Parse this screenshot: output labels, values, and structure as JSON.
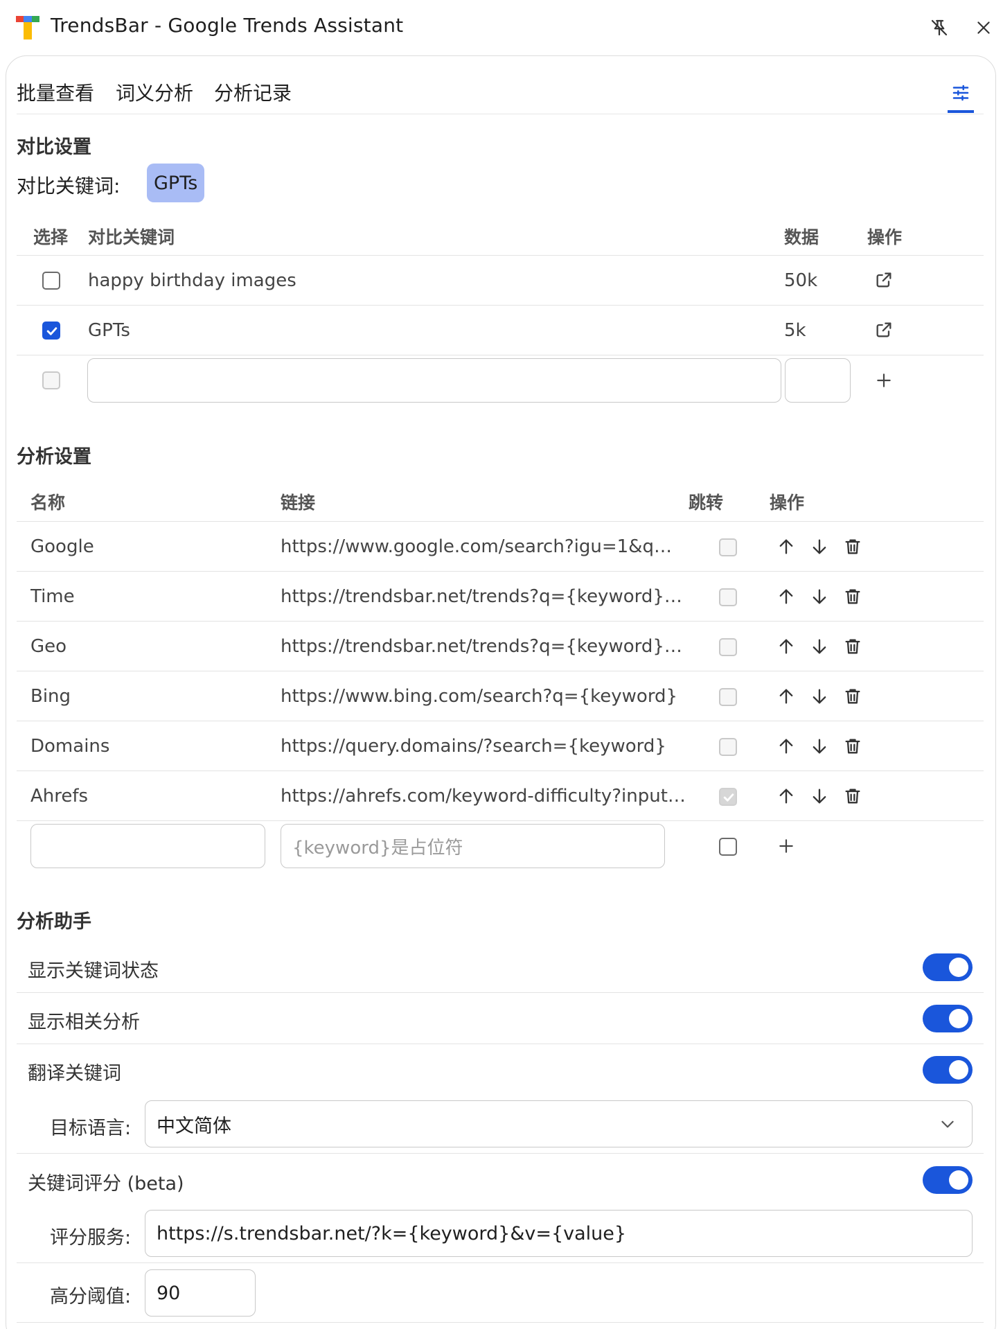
{
  "window": {
    "title": "TrendsBar - Google Trends Assistant"
  },
  "tabs": [
    {
      "label": "批量查看"
    },
    {
      "label": "词义分析"
    },
    {
      "label": "分析记录"
    }
  ],
  "compare": {
    "section_title": "对比设置",
    "keyword_label": "对比关键词:",
    "active_keyword": "GPTs",
    "headers": {
      "select": "选择",
      "keyword": "对比关键词",
      "data": "数据",
      "action": "操作"
    },
    "rows": [
      {
        "keyword": "happy birthday images",
        "data": "50k",
        "checked": false
      },
      {
        "keyword": "GPTs",
        "data": "5k",
        "checked": true
      }
    ],
    "new_keyword_value": "",
    "new_data_value": ""
  },
  "analysis": {
    "section_title": "分析设置",
    "headers": {
      "name": "名称",
      "link": "链接",
      "jump": "跳转",
      "action": "操作"
    },
    "rows": [
      {
        "name": "Google",
        "link": "https://www.google.com/search?igu=1&q={key...",
        "jump": false
      },
      {
        "name": "Time",
        "link": "https://trendsbar.net/trends?q={keyword}&ge...",
        "jump": false
      },
      {
        "name": "Geo",
        "link": "https://trendsbar.net/trends?q={keyword}&ge...",
        "jump": false
      },
      {
        "name": "Bing",
        "link": "https://www.bing.com/search?q={keyword}",
        "jump": false
      },
      {
        "name": "Domains",
        "link": "https://query.domains/?search={keyword}",
        "jump": false
      },
      {
        "name": "Ahrefs",
        "link": "https://ahrefs.com/keyword-difficulty?input={k...",
        "jump": true
      }
    ],
    "new_name_value": "",
    "new_link_placeholder": "{keyword}是占位符"
  },
  "assistant": {
    "section_title": "分析助手",
    "options": [
      {
        "label": "显示关键词状态",
        "enabled": true
      },
      {
        "label": "显示相关分析",
        "enabled": true
      },
      {
        "label": "翻译关键词",
        "enabled": true
      },
      {
        "label": "关键词评分 (beta)",
        "enabled": true
      }
    ],
    "target_language_label": "目标语言:",
    "target_language_value": "中文简体",
    "score_service_label": "评分服务:",
    "score_service_value": "https://s.trendsbar.net/?k={keyword}&v={value}",
    "threshold_label": "高分阈值:",
    "threshold_value": "90"
  },
  "colors": {
    "accent": "#1a56db",
    "chip": "#a9bcf5",
    "divider": "#e3e3e3"
  }
}
